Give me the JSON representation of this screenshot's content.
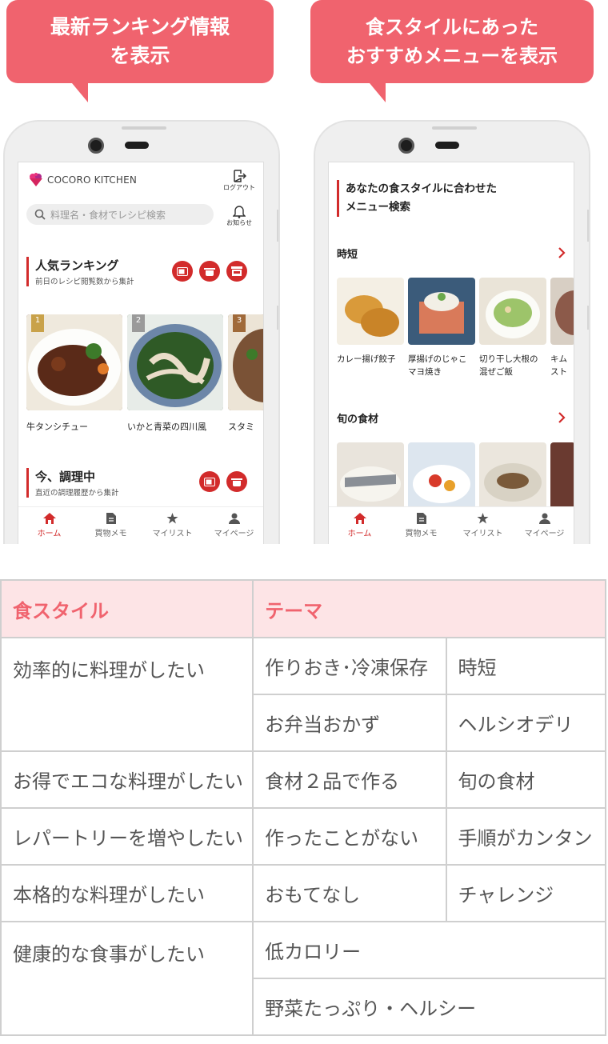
{
  "bubbles": {
    "left": [
      "最新ランキング情報",
      "を表示"
    ],
    "right": [
      "食スタイルにあった",
      "おすすめメニューを表示"
    ]
  },
  "left_screen": {
    "logo": "COCORO KITCHEN",
    "logout": "ログアウト",
    "notice": "お知らせ",
    "search_placeholder": "料理名・食材でレシピ検索",
    "ranking": {
      "title": "人気ランキング",
      "subtitle": "前日のレシピ閲覧数から集計"
    },
    "rank_items": [
      {
        "rank": "1",
        "name": "牛タンシチュー"
      },
      {
        "rank": "2",
        "name": "いかと青菜の四川風"
      },
      {
        "rank": "3",
        "name": "スタミ"
      }
    ],
    "cooking": {
      "title": "今、調理中",
      "subtitle": "直近の調理履歴から集計"
    }
  },
  "right_screen": {
    "heading": [
      "あなたの食スタイルに合わせた",
      "メニュー検索"
    ],
    "section1": "時短",
    "section1_items": [
      [
        "カレー揚げ餃子",
        ""
      ],
      [
        "厚揚げのじゃこ",
        "マヨ焼き"
      ],
      [
        "切り干し大根の",
        "混ぜご飯"
      ],
      [
        "キム",
        "スト"
      ]
    ],
    "section2": "旬の食材"
  },
  "tabbar": [
    "ホーム",
    "買物メモ",
    "マイリスト",
    "マイページ"
  ],
  "table": {
    "headers": [
      "食スタイル",
      "テーマ"
    ],
    "rows": [
      {
        "style": "効率的に料理がしたい",
        "themes": [
          [
            "作りおき･冷凍保存",
            "時短"
          ],
          [
            "お弁当おかず",
            "ヘルシオデリ"
          ]
        ]
      },
      {
        "style": "お得でエコな料理がしたい",
        "themes": [
          [
            "食材２品で作る",
            "旬の食材"
          ]
        ]
      },
      {
        "style": "レパートリーを増やしたい",
        "themes": [
          [
            "作ったことがない",
            "手順がカンタン"
          ]
        ]
      },
      {
        "style": "本格的な料理がしたい",
        "themes": [
          [
            "おもてなし",
            "チャレンジ"
          ]
        ]
      },
      {
        "style": "健康的な食事がしたい",
        "themes": [
          [
            "低カロリー"
          ],
          [
            "野菜たっぷり・ヘルシー"
          ]
        ]
      }
    ]
  },
  "colors": {
    "accent": "#f0636e",
    "red": "#d22b2b",
    "header_bg": "#fde4e6"
  }
}
